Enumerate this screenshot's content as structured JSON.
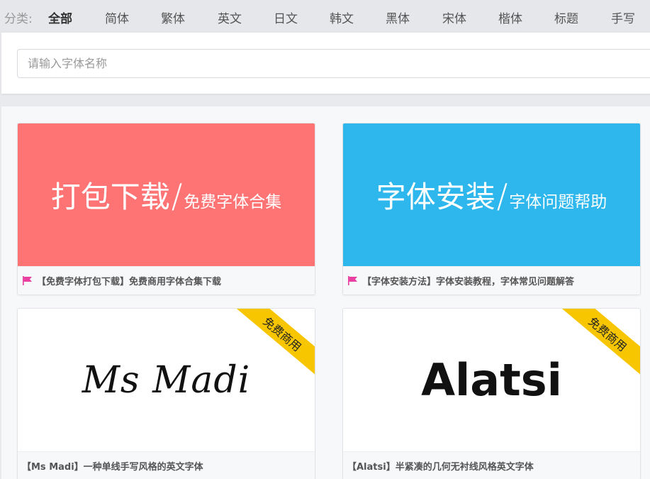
{
  "categories": {
    "label": "分类:",
    "items": [
      {
        "label": "全部",
        "active": true
      },
      {
        "label": "简体"
      },
      {
        "label": "繁体"
      },
      {
        "label": "英文"
      },
      {
        "label": "日文"
      },
      {
        "label": "韩文"
      },
      {
        "label": "黑体"
      },
      {
        "label": "宋体"
      },
      {
        "label": "楷体"
      },
      {
        "label": "标题"
      },
      {
        "label": "手写"
      }
    ]
  },
  "search": {
    "placeholder": "请输入字体名称",
    "value": ""
  },
  "cards": [
    {
      "banner_main": "打包下载",
      "banner_slash": "/",
      "banner_sub": "免费字体合集",
      "banner_color": "#fe7373",
      "caption": "【免费字体打包下载】免费商用字体合集下载",
      "flag_icon": "flag-icon",
      "flag_color": "#e83fa0"
    },
    {
      "banner_main": "字体安装",
      "banner_slash": "/",
      "banner_sub": "字体问题帮助",
      "banner_color": "#2db7ec",
      "caption": "【字体安装方法】字体安装教程，字体常见问题解答",
      "flag_icon": "flag-icon",
      "flag_color": "#e83fa0"
    },
    {
      "preview": "Ms Madi",
      "ribbon": "免费商用",
      "ribbon_color": "#f7c600",
      "caption": "【Ms Madi】一种单线手写风格的英文字体"
    },
    {
      "preview": "Alatsi",
      "ribbon": "免费商用",
      "ribbon_color": "#f7c600",
      "caption": "【Alatsi】半紧凑的几何无衬线风格英文字体"
    }
  ]
}
